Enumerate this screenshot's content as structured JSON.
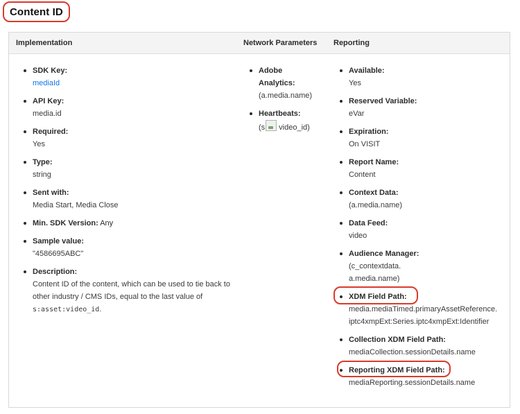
{
  "title": "Content ID",
  "columns": {
    "implementation": "Implementation",
    "network": "Network Parameters",
    "reporting": "Reporting"
  },
  "implementation": {
    "sdk_key_label": "SDK Key:",
    "sdk_key_value": "mediaId",
    "api_key_label": "API Key:",
    "api_key_value": "media.id",
    "required_label": "Required:",
    "required_value": "Yes",
    "type_label": "Type:",
    "type_value": "string",
    "sent_with_label": "Sent with:",
    "sent_with_value": "Media Start, Media Close",
    "min_sdk_label": "Min. SDK Version:",
    "min_sdk_value": " Any",
    "sample_label": "Sample value:",
    "sample_value": "\"4586695ABC\"",
    "description_label": "Description:",
    "description_text": "Content ID of the content, which can be used to tie back to other industry / CMS IDs, equal to the last value of ",
    "description_code": "s:asset:video_id",
    "description_end": "."
  },
  "network": {
    "adobe_label_line1": "Adobe",
    "adobe_label_line2": "Analytics:",
    "adobe_value": "(a.media.name)",
    "heartbeats_label": "Heartbeats:",
    "heartbeats_value_prefix": "(s",
    "heartbeats_value_suffix": "video_id)"
  },
  "reporting": {
    "available_label": "Available:",
    "available_value": "Yes",
    "reserved_label": "Reserved Variable:",
    "reserved_value": "eVar",
    "expiration_label": "Expiration:",
    "expiration_value": "On VISIT",
    "report_name_label": "Report Name:",
    "report_name_value": "Content",
    "context_label": "Context Data:",
    "context_value": "(a.media.name)",
    "data_feed_label": "Data Feed:",
    "data_feed_value": "video",
    "audience_label": "Audience Manager:",
    "audience_value_line1": "(c_contextdata.",
    "audience_value_line2": "a.media.name)",
    "xdm_label": "XDM Field Path:",
    "xdm_value_line1": "media.mediaTimed.primaryAssetReference.",
    "xdm_value_line2": "iptc4xmpExt:Series.iptc4xmpExt:Identifier",
    "collection_label": "Collection XDM Field Path:",
    "collection_value": "mediaCollection.sessionDetails.name",
    "reporting_xdm_label": "Reporting XDM Field Path:",
    "reporting_xdm_value": "mediaReporting.sessionDetails.name"
  },
  "colors": {
    "highlight": "#d93b2b",
    "link": "#1473e6",
    "header_bg": "#f4f4f4"
  },
  "icons": {
    "heartbeats_image": "broken-image-icon"
  }
}
